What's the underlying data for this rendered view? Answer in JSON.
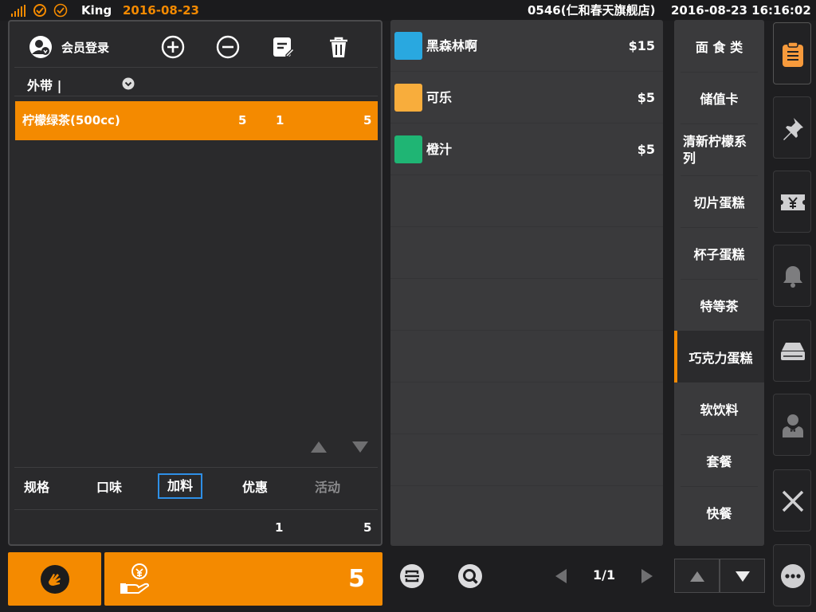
{
  "topbar": {
    "user": "King",
    "date": "2016-08-23",
    "store": "0546(仁和春天旗舰店)",
    "datetime": "2016-08-23 16:16:02"
  },
  "order": {
    "member_login": "会员登录",
    "order_type": "外带 |",
    "items": [
      {
        "name": "柠檬绿茶(500cc)",
        "price": "5",
        "qty": "1",
        "total": "5"
      }
    ],
    "tabs": [
      "规格",
      "口味",
      "加料",
      "优惠",
      "活动"
    ],
    "selected_tab": "加料",
    "summary_qty": "1",
    "summary_total": "5"
  },
  "products": [
    {
      "name": "黑森林啊",
      "price": "$15",
      "color": "#29a8e0"
    },
    {
      "name": "可乐",
      "price": "$5",
      "color": "#f8ad3c"
    },
    {
      "name": "橙汁",
      "price": "$5",
      "color": "#1fb574"
    }
  ],
  "categories": [
    "面 食 类",
    "储值卡",
    "清新柠檬系列",
    "切片蛋糕",
    "杯子蛋糕",
    "特等茶",
    "巧克力蛋糕",
    "软饮料",
    "套餐",
    "快餐"
  ],
  "selected_category": "巧克力蛋糕",
  "bottom": {
    "pay_amount": "5",
    "page_indicator": "1/1"
  },
  "colors": {
    "accent": "#f48a00",
    "selected_tab_border": "#2e8fe6"
  }
}
